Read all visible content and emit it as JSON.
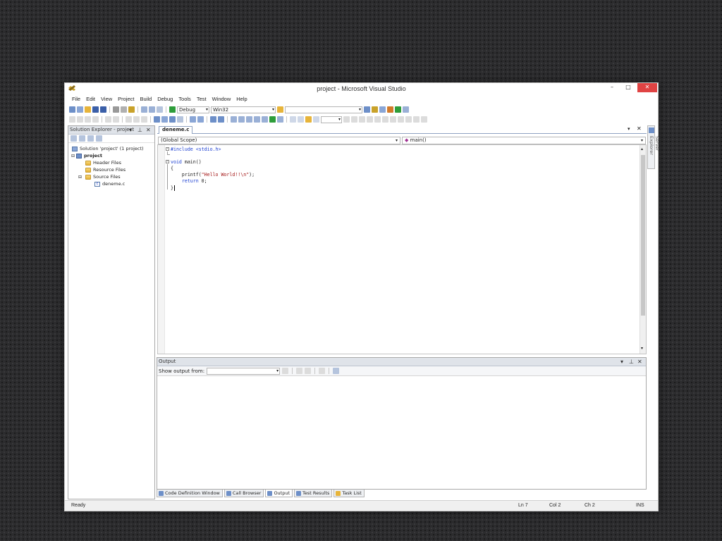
{
  "window": {
    "title": "project - Microsoft Visual Studio",
    "minimize_glyph": "–",
    "maximize_glyph": "□",
    "close_glyph": "✕"
  },
  "menu": [
    "File",
    "Edit",
    "View",
    "Project",
    "Build",
    "Debug",
    "Tools",
    "Test",
    "Window",
    "Help"
  ],
  "toolbar": {
    "config": "Debug",
    "platform": "Win32",
    "find_value": ""
  },
  "solution_explorer": {
    "title": "Solution Explorer - project",
    "solution": "Solution 'project' (1 project)",
    "project": "project",
    "header_files": "Header Files",
    "resource_files": "Resource Files",
    "source_files": "Source Files",
    "file": "deneme.c"
  },
  "editor": {
    "tab": "deneme.c",
    "scope": "(Global Scope)",
    "function": "main()",
    "lines": {
      "l1_kw": "#include",
      "l1_rest": " <stdio.h>",
      "l3_kw": "void",
      "l3_rest": " main()",
      "l4": "{",
      "l5_pre": "    printf(",
      "l5_str": "\"Hello World!!\\n\"",
      "l5_post": ");",
      "l6_kw": "    return",
      "l6_rest": " 0;",
      "l7": "}"
    }
  },
  "output": {
    "title": "Output",
    "show_from": "Show output from:"
  },
  "bottom_tabs": [
    "Code Definition Window",
    "Call Browser",
    "Output",
    "Test Results",
    "Task List"
  ],
  "server_explorer": "Server Explorer",
  "status": {
    "ready": "Ready",
    "ln": "Ln 7",
    "col": "Col 2",
    "ch": "Ch 2",
    "ins": "INS"
  },
  "colors": {
    "accent": "#1c3fd1",
    "string": "#a31515",
    "close": "#e04343"
  }
}
